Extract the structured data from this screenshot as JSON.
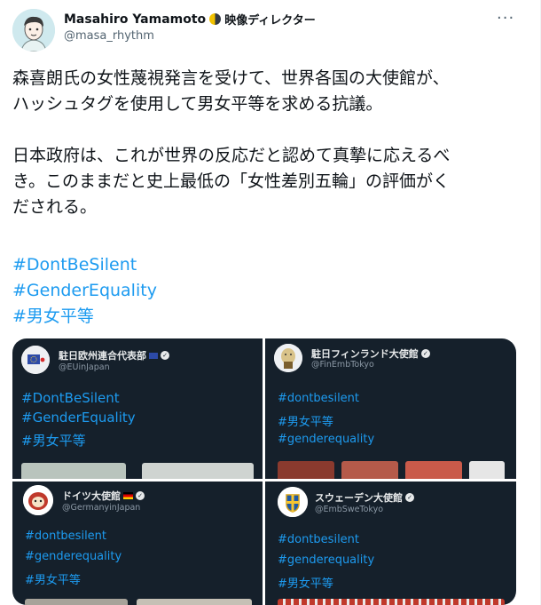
{
  "tweet": {
    "author_name": "Masahiro Yamamoto",
    "author_suffix": "映像ディレクター",
    "handle": "@masa_rhythm",
    "more_icon": "more-icon",
    "text": "森喜朗氏の女性蔑視発言を受けて、世界各国の大使館が、\nハッシュタグを使用して男女平等を求める抗議。\n\n日本政府は、これが世界の反応だと認めて真摯に応えるべ\nき。このままだと史上最低の「女性差別五輪」の評価がく\nだされる。",
    "hashtags": [
      "#DontBeSilent",
      "#GenderEquality",
      "#男女平等"
    ]
  },
  "media": {
    "panels": [
      {
        "name": "駐日欧州連合代表部",
        "handle": "@EUinJapan",
        "tags": [
          "#DontBeSilent",
          "#GenderEquality",
          "#男女平等"
        ]
      },
      {
        "name": "駐日フィンランド大使館",
        "handle": "@FinEmbTokyo",
        "tags": [
          "#dontbesilent",
          "#男女平等",
          "#genderequality"
        ]
      },
      {
        "name": "ドイツ大使館",
        "handle": "@GermanyinJapan",
        "tags": [
          "#dontbesilent",
          "#genderequality",
          "#男女平等"
        ]
      },
      {
        "name": "スウェーデン大使館",
        "handle": "@EmbSweTokyo",
        "tags": [
          "#dontbesilent",
          "#genderequality",
          "#男女平等"
        ]
      }
    ]
  },
  "colors": {
    "hashtag": "#1d9bf0",
    "panel_bg": "#15202b"
  }
}
